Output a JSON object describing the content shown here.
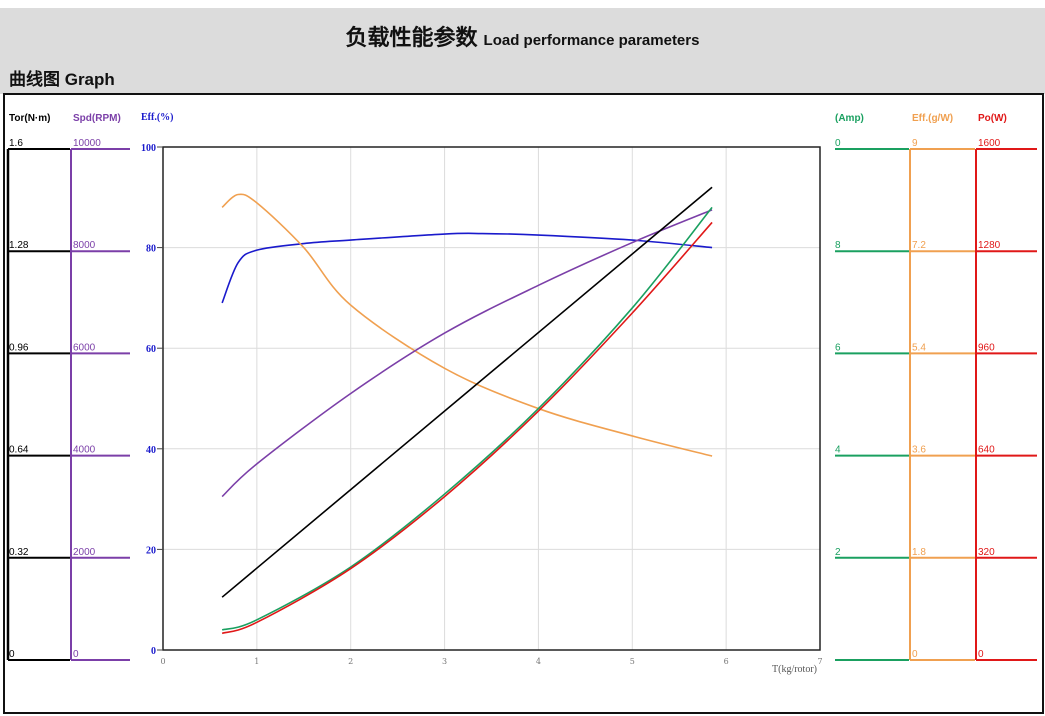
{
  "header": {
    "title_cn": "负载性能参数",
    "title_en": "Load performance parameters",
    "section": "曲线图 Graph"
  },
  "chart_data": {
    "type": "line",
    "xlabel": "T(kg/rotor)",
    "xlim": [
      0,
      7
    ],
    "x_ticks": [
      "0",
      "1",
      "2",
      "3",
      "4",
      "5",
      "6",
      "7"
    ],
    "grid": true,
    "axes": [
      {
        "id": "tor",
        "label": "Tor(N·m)",
        "color": "#000000",
        "ticks": [
          "1.6",
          "1.28",
          "0.96",
          "0.64",
          "0.32",
          "0"
        ],
        "max": 1.6
      },
      {
        "id": "spd",
        "label": "Spd(RPM)",
        "color": "#7b3fa8",
        "ticks": [
          "10000",
          "8000",
          "6000",
          "4000",
          "2000",
          "0"
        ],
        "max": 10000
      },
      {
        "id": "eff",
        "label": "Eff.(%)",
        "color": "#1a1acc",
        "ticks": [
          "100",
          "80",
          "60",
          "40",
          "20",
          "0"
        ],
        "max": 100
      },
      {
        "id": "amp",
        "label": "(Amp)",
        "color": "#1aa060",
        "ticks": [
          "0",
          "8",
          "6",
          "4",
          "2",
          ""
        ],
        "max": 10
      },
      {
        "id": "gw",
        "label": "Eff.(g/W)",
        "color": "#f0a050",
        "ticks": [
          "9",
          "7.2",
          "5.4",
          "3.6",
          "1.8",
          "0"
        ],
        "max": 9
      },
      {
        "id": "po",
        "label": "Po(W)",
        "color": "#e01818",
        "ticks": [
          "1600",
          "1280",
          "960",
          "640",
          "320",
          "0"
        ],
        "max": 1600
      }
    ],
    "series": [
      {
        "name": "Efficiency (%)",
        "axis": "eff",
        "color": "#1a1acc",
        "x": [
          0.63,
          0.8,
          1,
          1.5,
          2,
          3,
          3.4,
          4,
          5,
          5.85
        ],
        "y": [
          69,
          77,
          79.5,
          80.8,
          81.5,
          82.7,
          82.8,
          82.5,
          81.5,
          80
        ]
      },
      {
        "name": "Efficiency (g/W)",
        "axis": "gw",
        "color": "#f0a050",
        "x": [
          0.63,
          0.8,
          1,
          1.5,
          2,
          3,
          4,
          5,
          5.85
        ],
        "y": [
          7.92,
          8.15,
          8.0,
          7.2,
          6.17,
          5.04,
          4.32,
          3.83,
          3.47
        ]
      },
      {
        "name": "Speed (RPM)",
        "axis": "spd",
        "color": "#7b3fa8",
        "x": [
          0.63,
          1,
          2,
          3,
          4,
          5,
          5.85
        ],
        "y": [
          3050,
          3700,
          5100,
          6300,
          7250,
          8100,
          8750
        ]
      },
      {
        "name": "Torque (N·m)",
        "axis": "tor",
        "color": "#000000",
        "x": [
          0.63,
          5.85
        ],
        "y": [
          0.168,
          1.472
        ]
      },
      {
        "name": "Current (Amp)",
        "axis": "amp",
        "color": "#1aa060",
        "x": [
          0.63,
          1,
          2,
          3,
          4,
          5,
          5.85
        ],
        "y": [
          0.4,
          0.6,
          1.65,
          3.1,
          4.8,
          6.8,
          8.8
        ]
      },
      {
        "name": "Power (W)",
        "axis": "po",
        "color": "#e01818",
        "x": [
          0.63,
          1,
          2,
          3,
          4,
          5,
          5.85
        ],
        "y": [
          53,
          88,
          259,
          488,
          760,
          1072,
          1360
        ]
      }
    ]
  }
}
